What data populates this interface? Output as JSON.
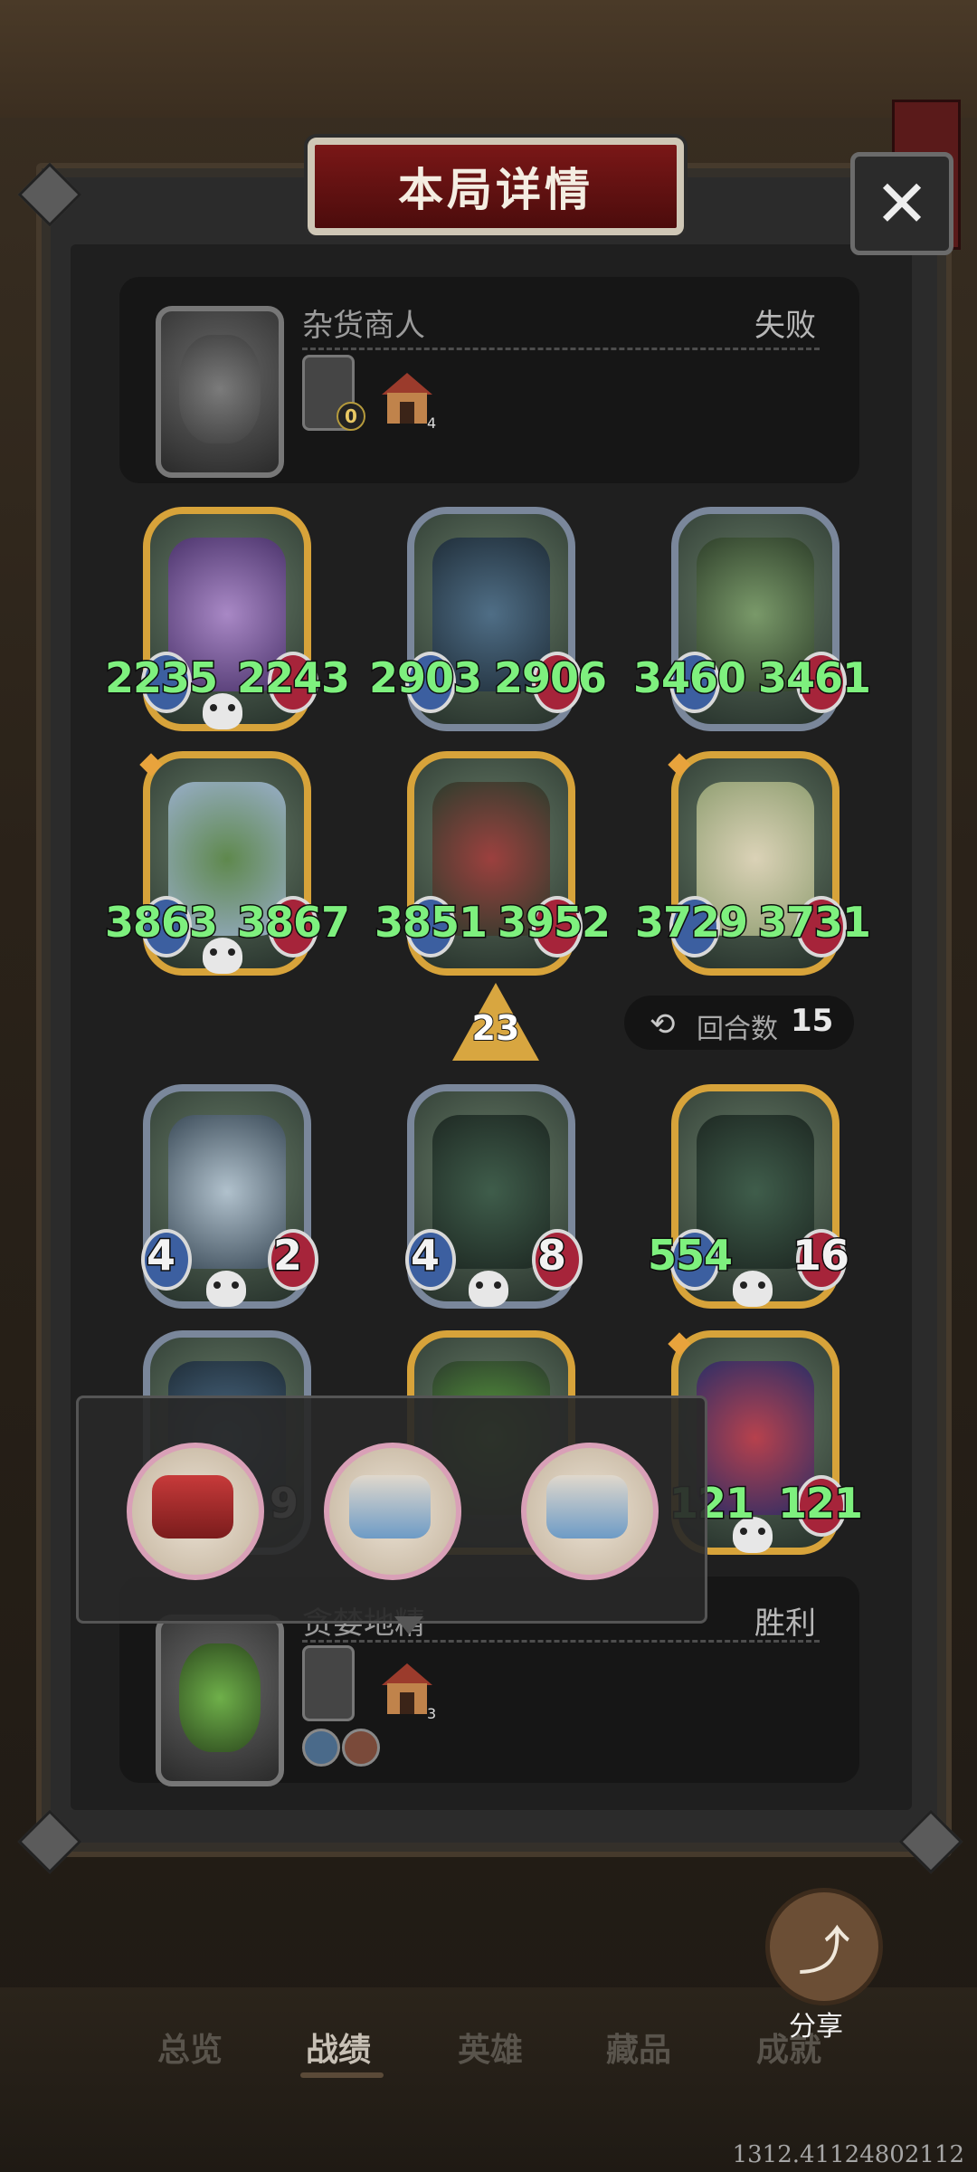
{
  "dialog": {
    "title": "本局详情",
    "close_icon": "close-icon"
  },
  "opponent": {
    "name": "杂货商人",
    "result": "失败",
    "level_badge": "0",
    "house_count": "4"
  },
  "player": {
    "name": "贪婪地精",
    "result": "胜利",
    "house_count": "3"
  },
  "opponent_heroes": [
    {
      "atk": "2235",
      "hp": "2243",
      "frame": "gold"
    },
    {
      "atk": "2903",
      "hp": "2906",
      "frame": "silver"
    },
    {
      "atk": "3460",
      "hp": "3461",
      "frame": "silver"
    },
    {
      "atk": "3863",
      "hp": "3867",
      "frame": "gold"
    },
    {
      "atk": "3851",
      "hp": "3952",
      "frame": "gold"
    },
    {
      "atk": "3729",
      "hp": "3731",
      "frame": "gold"
    }
  ],
  "level": "23",
  "rounds": {
    "label": "回合数",
    "value": "15"
  },
  "player_heroes": [
    {
      "atk": "4",
      "hp": "2",
      "frame": "silver"
    },
    {
      "atk": "4",
      "hp": "8",
      "frame": "silver"
    },
    {
      "atk": "554",
      "hp": "16",
      "frame": "gold"
    },
    {
      "atk": "9",
      "hp": "",
      "frame": "silver"
    },
    {
      "atk": "",
      "hp": "",
      "frame": "gold"
    },
    {
      "atk": "121",
      "hp": "121",
      "frame": "gold"
    }
  ],
  "items_popup": [
    "drum-item-icon",
    "knight-figurine-icon",
    "knight-figurine-icon"
  ],
  "share": {
    "label": "分享"
  },
  "tabs": [
    "总览",
    "战绩",
    "英雄",
    "藏品",
    "成就"
  ],
  "coordinates": "1312.41124802112"
}
